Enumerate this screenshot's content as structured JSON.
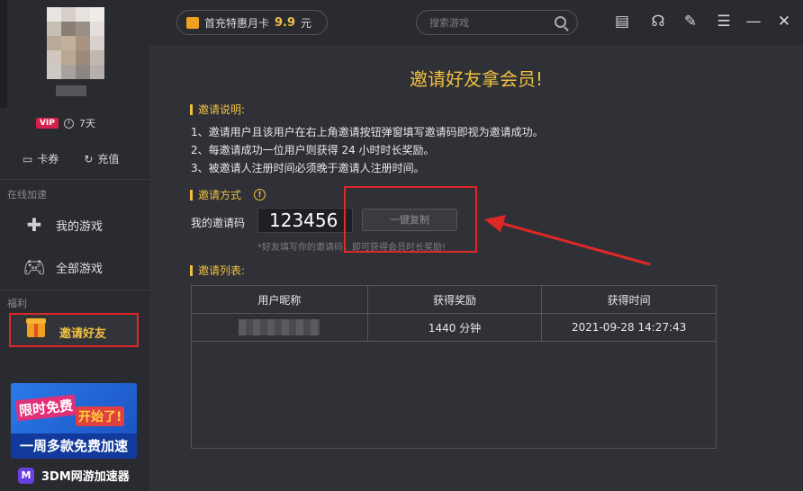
{
  "sidebar": {
    "vip_label": "VIP",
    "vip_days": "7天",
    "card_label": "卡券",
    "recharge_label": "充值",
    "section_online": "在线加速",
    "my_games": "我的游戏",
    "all_games": "全部游戏",
    "section_welfare": "福利",
    "invite_friends": "邀请好友",
    "promo_line1": "限时免费",
    "promo_line2": "开始了!",
    "promo_line3": "一周多款免费加速",
    "brand": "3DM网游加速器"
  },
  "topbar": {
    "promo_text": "首充特惠月卡",
    "promo_price": "9.9",
    "promo_unit": "元",
    "search_placeholder": "搜索游戏"
  },
  "main": {
    "title": "邀请好友拿会员!",
    "rules_head": "邀请说明:",
    "rules": [
      "1、邀请用户且该用户在右上角邀请按钮弹窗填写邀请码即视为邀请成功。",
      "2、每邀请成功一位用户则获得 24 小时时长奖励。",
      "3、被邀请人注册时间必须晚于邀请人注册时间。"
    ],
    "method_head": "邀请方式",
    "code_label": "我的邀请码",
    "code_value": "123456",
    "copy_button": "一键复制",
    "hint": "*好友填写你的邀请码，即可获得会员时长奖励!",
    "list_head": "邀请列表:",
    "table": {
      "headers": [
        "用户昵称",
        "获得奖励",
        "获得时间"
      ],
      "rows": [
        {
          "reward": "1440 分钟",
          "time": "2021-09-28 14:27:43"
        }
      ]
    }
  },
  "colors": {
    "accent": "#f0c040",
    "annotation": "#e02828"
  }
}
